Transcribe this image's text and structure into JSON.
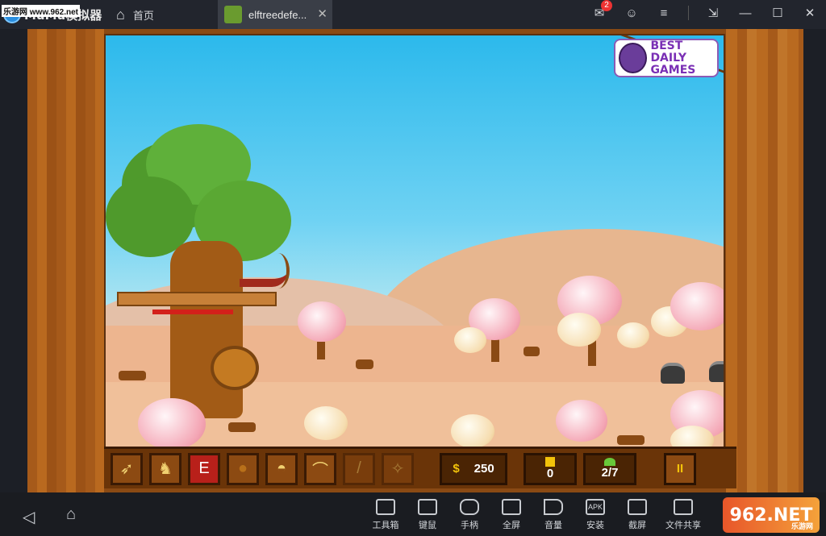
{
  "titlebar": {
    "brand": "MuMu模拟器",
    "site_tag": "乐游网 www.962.net",
    "home_label": "首页",
    "tab_title": "elftreedefe...",
    "close_glyph": "✕",
    "mail_badge": "2"
  },
  "game": {
    "sponsor_line1": "BEST DAILY",
    "sponsor_line2": "GAMES",
    "money_symbol": "$",
    "money": "250",
    "gold": "0",
    "wave": "2/7",
    "pause_glyph": "II",
    "weapon_slots": [
      "crossbow-bolt-icon",
      "horned-helmet-icon",
      "elf-shield-icon",
      "pinecone-bomb-icon",
      "golden-helmet-icon",
      "bow-icon",
      "staff-icon",
      "wing-icon"
    ],
    "slot_glyphs": [
      "➶",
      "♞",
      "E",
      "●",
      "◓",
      "⌒",
      "/",
      "✧"
    ]
  },
  "dock": {
    "back_glyph": "◁",
    "home_glyph": "⌂",
    "tools": [
      {
        "label": "工具箱",
        "icon": "toolbox-icon"
      },
      {
        "label": "键鼠",
        "icon": "keyboard-icon"
      },
      {
        "label": "手柄",
        "icon": "gamepad-icon"
      },
      {
        "label": "全屏",
        "icon": "fullscreen-icon"
      },
      {
        "label": "音量",
        "icon": "volume-icon"
      },
      {
        "label": "安装",
        "icon": "apk-icon",
        "glyph": "APK"
      },
      {
        "label": "截屏",
        "icon": "crop-icon"
      },
      {
        "label": "文件共享",
        "icon": "folder-icon"
      }
    ],
    "watermark": "962.NET",
    "watermark_sub": "乐游网"
  }
}
